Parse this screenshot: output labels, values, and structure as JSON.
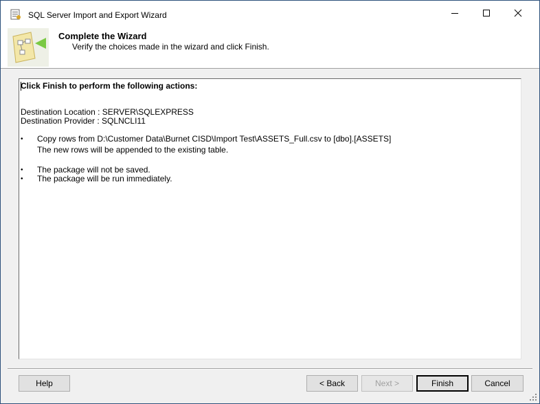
{
  "window": {
    "title": "SQL Server Import and Export Wizard",
    "icon": "wizard-app-icon",
    "controls": [
      "minimize-icon",
      "maximize-icon",
      "close-icon"
    ]
  },
  "header": {
    "title": "Complete the Wizard",
    "subtitle": "Verify the choices made in the wizard and click Finish."
  },
  "summary": {
    "heading": "Click Finish to perform the following actions:",
    "destination_location": "Destination Location : SERVER\\SQLEXPRESS",
    "destination_provider": "Destination Provider : SQLNCLI11",
    "actions": [
      {
        "bullet": "•",
        "text": "Copy rows from D:\\Customer Data\\Burnet CISD\\Import Test\\ASSETS_Full.csv to [dbo].[ASSETS]",
        "detail": "The new rows will be appended to the existing table."
      },
      {
        "bullet": "•",
        "text": "The package will not be saved."
      },
      {
        "bullet": "•",
        "text": "The package will be run immediately."
      }
    ]
  },
  "footer": {
    "help_label": "Help",
    "back_label": "< Back",
    "next_label": "Next >",
    "finish_label": "Finish",
    "cancel_label": "Cancel"
  }
}
